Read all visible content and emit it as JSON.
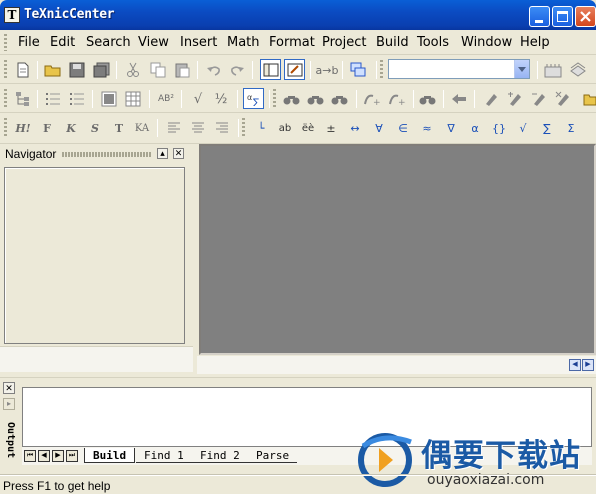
{
  "window": {
    "title": "TeXnicCenter",
    "app_icon": "T"
  },
  "menu": [
    "File",
    "Edit",
    "Search",
    "View",
    "Insert",
    "Math",
    "Format",
    "Project",
    "Build",
    "Tools",
    "Window",
    "Help"
  ],
  "toolbar1": {
    "icons": [
      "new-document-icon",
      "open-folder-icon",
      "save-icon",
      "save-all-icon",
      "cut-icon",
      "copy-icon",
      "paste-icon",
      "undo-icon",
      "redo-icon",
      "navigator-toggle-icon",
      "output-toggle-icon",
      "compile-ab-icon",
      "window-switch-icon",
      "build-icon",
      "view-output-icon"
    ],
    "compile_label": "a→b",
    "output_profile_combo": {
      "value": ""
    }
  },
  "toolbar2": {
    "icons": [
      "structure-icon",
      "list-icon",
      "enumerate-icon",
      "table-icon",
      "tabular-icon",
      "superscript-icon",
      "sqrt-icon",
      "fraction-icon",
      "math-symbol-icon",
      "find-icon",
      "find-next-icon",
      "find-prev-icon",
      "bookmark-next-icon",
      "bookmark-prev-icon",
      "binoculars-icon",
      "arrow-left-icon",
      "pen-icon",
      "pen-plus-icon",
      "pen-minus-icon",
      "pen-clear-icon",
      "folder-icon"
    ],
    "superscript_label": "AB²",
    "sqrt_label": "√",
    "fraction_label": "½"
  },
  "toolbar3": {
    "format_labels": [
      "H!",
      "F",
      "K",
      "S",
      "T",
      "KA"
    ],
    "symbol_labels": [
      "└",
      "ab",
      "ëè",
      "±",
      "↔",
      "∀",
      "∈",
      "≈",
      "∇",
      "α",
      "{}",
      "√",
      "∑",
      "Σ"
    ]
  },
  "navigator": {
    "title": "Navigator",
    "close": "✕",
    "collapse": "▴"
  },
  "output": {
    "label": "Output",
    "close": "✕",
    "pin": "▸",
    "tabs": [
      "Build",
      "Find 1",
      "Find 2",
      "Parse"
    ],
    "active_tab": "Build"
  },
  "scroll": {
    "left": "◀",
    "right": "▶"
  },
  "tab_nav": [
    "⏮",
    "◀",
    "▶",
    "⏭"
  ],
  "watermark": {
    "title": "偶要下载站",
    "url": "ouyaoxiazai.com"
  },
  "status": {
    "text": "Press F1 to get help"
  },
  "colors": {
    "titlebar": "#0a4bc2",
    "face": "#ece9d8",
    "editor_bg": "#808080",
    "accent": "#316ac5"
  }
}
